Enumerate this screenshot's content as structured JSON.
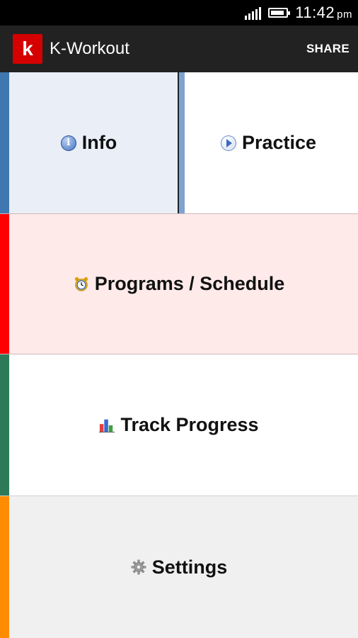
{
  "status_bar": {
    "time": "11:42",
    "ampm": "pm"
  },
  "app_bar": {
    "logo_letter": "k",
    "title": "K-Workout",
    "share_label": "SHARE"
  },
  "tiles": {
    "info": {
      "label": "Info",
      "stripe_color": "#3f78b0",
      "background": "#eaeff7",
      "icon": "info-icon"
    },
    "practice": {
      "label": "Practice",
      "stripe_color": "#7fa3cf",
      "background": "#ffffff",
      "icon": "play-icon"
    },
    "programs": {
      "label": "Programs / Schedule",
      "stripe_color": "#ff0000",
      "background": "#ffeaea",
      "icon": "alarm-clock-icon"
    },
    "track": {
      "label": "Track Progress",
      "stripe_color": "#2c7a57",
      "background": "#ffffff",
      "icon": "bar-chart-icon"
    },
    "settings": {
      "label": "Settings",
      "stripe_color": "#ff8c00",
      "background": "#f0f0f0",
      "icon": "gear-icon"
    }
  },
  "colors": {
    "status_bar": "#000000",
    "action_bar": "#222222",
    "logo": "#d50000"
  }
}
